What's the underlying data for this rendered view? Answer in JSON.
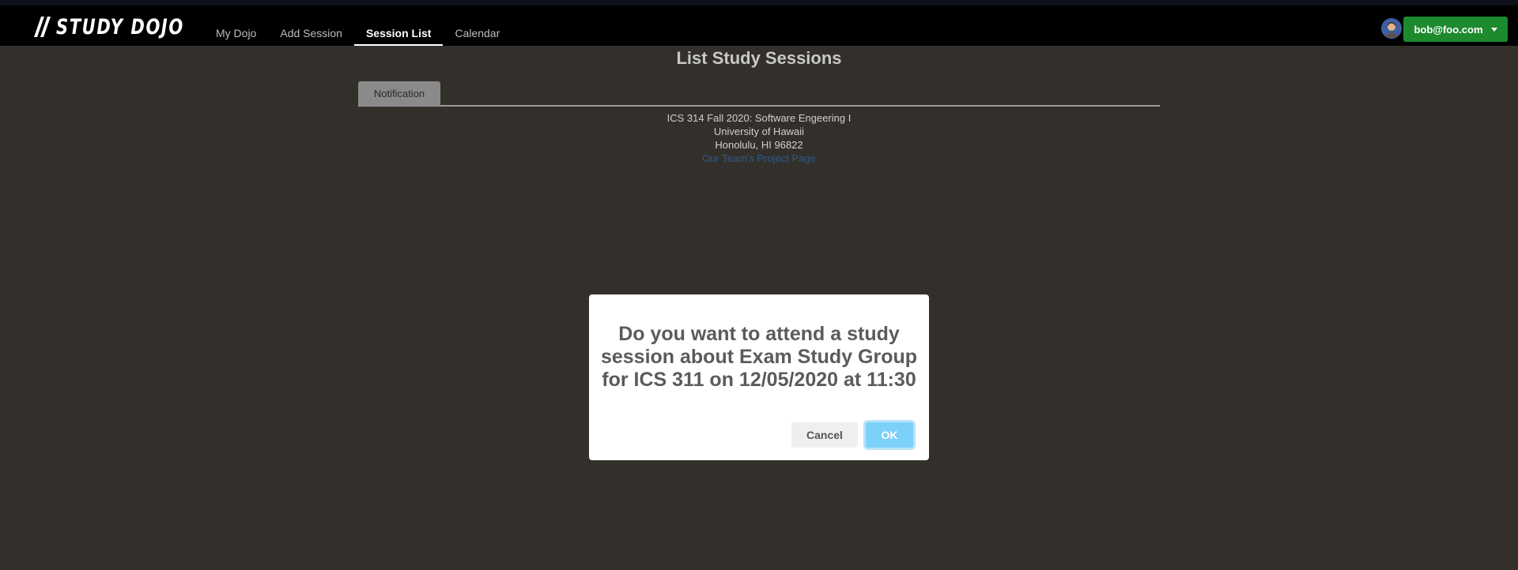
{
  "brand": {
    "logo_text": "STUDY DOJO",
    "logo_icon": "slash-mark-icon"
  },
  "nav": {
    "items": [
      {
        "label": "My Dojo",
        "active": false
      },
      {
        "label": "Add Session",
        "active": false
      },
      {
        "label": "Session List",
        "active": true
      },
      {
        "label": "Calendar",
        "active": false
      }
    ]
  },
  "user": {
    "email": "bob@foo.com",
    "avatar_icon": "user-avatar-icon",
    "button_color": "#1e8a2e"
  },
  "page": {
    "title": "List Study Sessions",
    "tabs": [
      {
        "label": "Notification"
      }
    ]
  },
  "footer": {
    "line1": "ICS 314 Fall 2020: Software Engeering I",
    "line2": "University of Hawaii",
    "line3": "Honolulu, HI 96822",
    "link": "Our Team's Project Page"
  },
  "dialog": {
    "message": "Do you want to attend a study session about Exam Study Group for ICS 311 on 12/05/2020 at 11:30",
    "cancel_label": "Cancel",
    "ok_label": "OK",
    "ok_color": "#7cd1f9"
  }
}
